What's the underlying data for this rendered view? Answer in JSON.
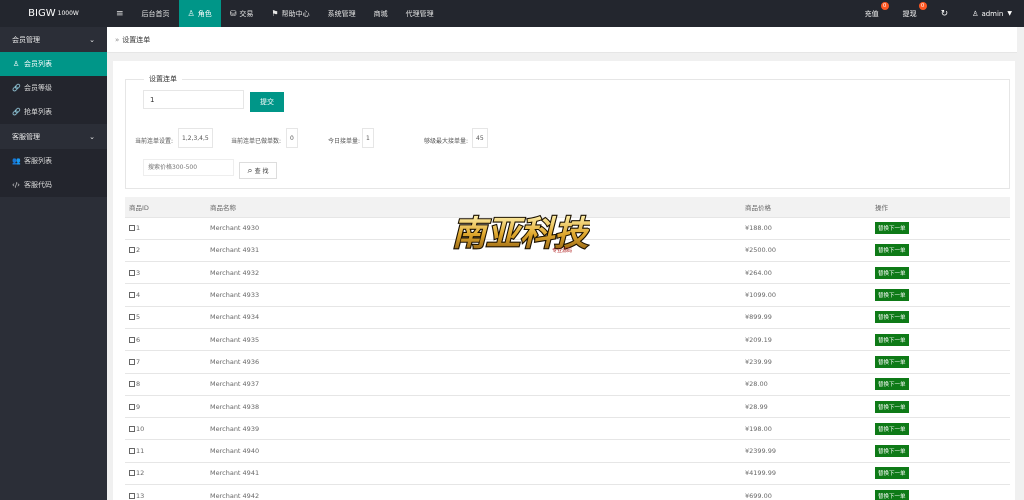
{
  "brand": {
    "name": "BIGW",
    "sup": "1000W"
  },
  "nav": [
    {
      "label": "后台首页",
      "icon": ""
    },
    {
      "label": "角色",
      "icon": "user-icon"
    },
    {
      "label": "交易",
      "icon": "database-icon"
    },
    {
      "label": "帮助中心",
      "icon": "flag-icon"
    },
    {
      "label": "系统管理",
      "icon": ""
    },
    {
      "label": "商城",
      "icon": ""
    },
    {
      "label": "代理管理",
      "icon": ""
    }
  ],
  "right_nav": {
    "recharge": {
      "label": "充值",
      "badge": "0"
    },
    "withdraw": {
      "label": "提现",
      "badge": "0"
    },
    "user": "admin"
  },
  "sidebar": {
    "group1": "会员管理",
    "items1": [
      {
        "label": "会员列表"
      },
      {
        "label": "会员等级"
      },
      {
        "label": "抢单列表"
      }
    ],
    "group2": "客服管理",
    "items2": [
      {
        "label": "客服列表"
      },
      {
        "label": "客服代码"
      }
    ]
  },
  "breadcrumb": "设置连单",
  "panel": {
    "legend": "设置连单",
    "input_value": "1",
    "submit_label": "提交",
    "stats": [
      {
        "label": "当前连单设置:",
        "value": "1,2,3,4,5"
      },
      {
        "label": "当前连单已做单数:",
        "value": "0"
      },
      {
        "label": "今日接单量:",
        "value": "1"
      },
      {
        "label": "够级最大接单量:",
        "value": "45"
      }
    ],
    "price_placeholder": "搜索价格300-500",
    "search_label": "查 找"
  },
  "table": {
    "headers": [
      "商品ID",
      "商品名称",
      "商品价格",
      "操作"
    ],
    "op_label": "替换下一单",
    "rows": [
      {
        "id": "1",
        "name": "Merchant 4930",
        "price": "¥188.00"
      },
      {
        "id": "2",
        "name": "Merchant 4931",
        "price": "¥2500.00"
      },
      {
        "id": "3",
        "name": "Merchant 4932",
        "price": "¥264.00"
      },
      {
        "id": "4",
        "name": "Merchant 4933",
        "price": "¥1099.00"
      },
      {
        "id": "5",
        "name": "Merchant 4934",
        "price": "¥899.99"
      },
      {
        "id": "6",
        "name": "Merchant 4935",
        "price": "¥209.19"
      },
      {
        "id": "7",
        "name": "Merchant 4936",
        "price": "¥239.99"
      },
      {
        "id": "8",
        "name": "Merchant 4937",
        "price": "¥28.00"
      },
      {
        "id": "9",
        "name": "Merchant 4938",
        "price": "¥28.99"
      },
      {
        "id": "10",
        "name": "Merchant 4939",
        "price": "¥198.00"
      },
      {
        "id": "11",
        "name": "Merchant 4940",
        "price": "¥2399.99"
      },
      {
        "id": "12",
        "name": "Merchant 4941",
        "price": "¥4199.99"
      },
      {
        "id": "13",
        "name": "Merchant 4942",
        "price": "¥699.00"
      }
    ]
  },
  "watermark": {
    "text": "南亚科技",
    "small": "专业源码"
  },
  "colors": {
    "accent": "#009688",
    "topbar": "#23262e",
    "sidebar": "#2b2e37",
    "op_button": "#0e7a17",
    "badge": "#ff5722"
  }
}
